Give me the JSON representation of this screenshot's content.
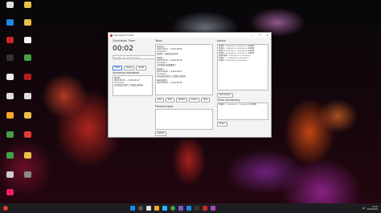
{
  "window": {
    "title": "Pomodoro Timer",
    "ctrl_min": "—",
    "ctrl_max": "☐",
    "ctrl_close": "✕"
  },
  "countdown": {
    "label": "Countdown Timer",
    "time": "00:02",
    "input_placeholder": "輸入時間（如：25m 或 1h30m）",
    "start": "Start",
    "pause": "Pause",
    "reset": "Reset",
    "upcoming_label": "Upcoming expiration",
    "upcoming_items": [
      "會議第三",
      "2024-08-20 ～ 2024-08-27",
      "Comment：",
      "每天會議記錄第三次會議記錄事項"
    ]
  },
  "tasks": {
    "label": "Tasks",
    "items": [
      "會議記法",
      "2024-08-01 ～ 2024-08-05",
      "Comment：",
      "會議第一天會議記錄事項",
      "",
      "會議第二",
      "2024-08-15 ～ 2024-08-16",
      "Comment：",
      "記得會議內容繼續進行",
      "",
      "會議第三 一",
      "2024-08-20 ～ 2024-08-27",
      "Comment：",
      "每天會議記錄第三次會議記錄事項",
      "",
      "補寫會議第三",
      "2024-08-25 ～ 2024-08-30"
    ],
    "buttons": [
      "Add",
      "Edit",
      "Delete",
      "Finish",
      "Vibe"
    ],
    "finished_label": "Finished tasks",
    "delete_label": "Delete"
  },
  "advice": {
    "label": "Advice",
    "lines": [
      "會議第三 2024-08-20～2024-08-27 完成時間",
      "會議第二 2024-08-15～2024-08-16 完成時間",
      "會議記法 2024-08-01～2024-08-05 完成時間",
      "會議第三 2024-08-20～2024-08-27 完成時間",
      "補寫會議第三 2024-08-25～2024-08-30",
      "會議第三 一 2024-08-20～2024-08-27",
      "會議第三 2024-08-20～2024-08-27"
    ],
    "get_advice": "Get Advice",
    "smart_label": "Smart Scheduling",
    "smart_lines": [
      "會議第三：2024-08-20 ～ 2024-08-27 完成時間"
    ],
    "enter": "Enter"
  },
  "taskbar": {
    "time": "12:56",
    "date": "2024/8/28",
    "lang": "中"
  },
  "colors": {
    "accent": "#3b7bd8",
    "window_bg": "#f3f3f3",
    "taskbar_bg": "#1e1e22"
  }
}
